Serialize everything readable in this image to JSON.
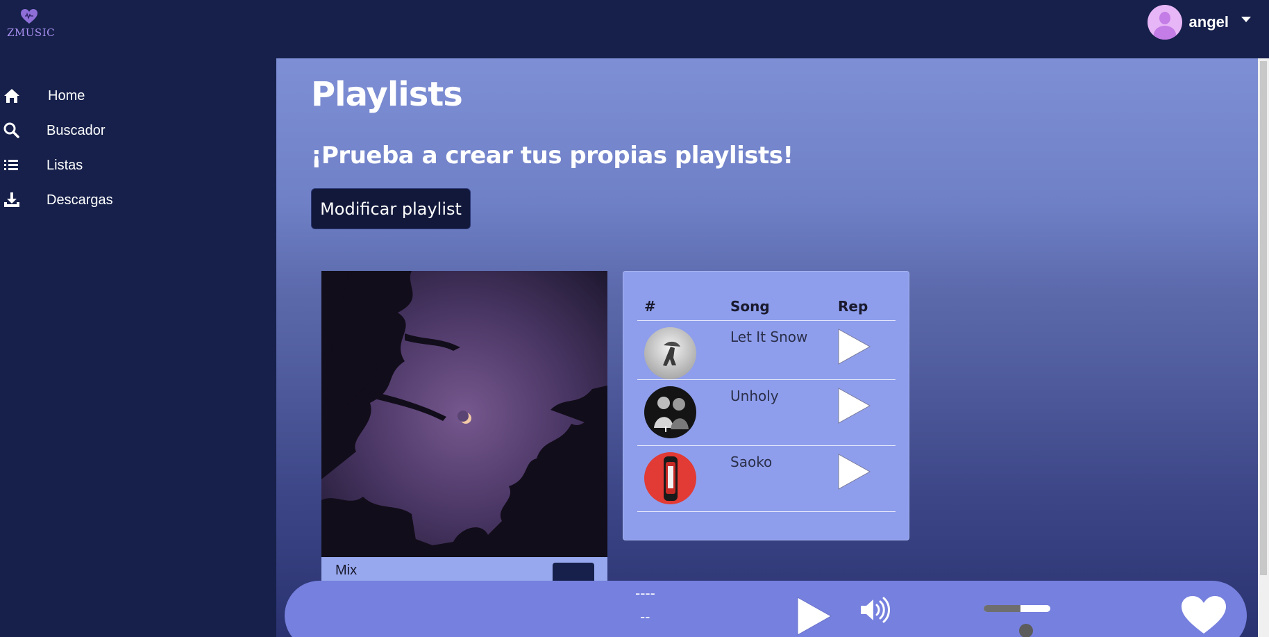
{
  "app": {
    "logo_text": "ZMUSIC"
  },
  "user": {
    "name": "angel"
  },
  "sidebar": {
    "items": [
      {
        "label": "Home",
        "icon": "home-icon"
      },
      {
        "label": "Buscador",
        "icon": "search-icon"
      },
      {
        "label": "Listas",
        "icon": "list-icon"
      },
      {
        "label": "Descargas",
        "icon": "download-icon"
      }
    ]
  },
  "main": {
    "title": "Playlists",
    "subtitle": "¡Prueba a crear tus propias playlists!",
    "modify_button": "Modificar playlist",
    "playlist_card": {
      "name": "Mix"
    },
    "table": {
      "headers": {
        "index": "#",
        "song": "Song",
        "rep": "Rep"
      },
      "rows": [
        {
          "title": "Let It Snow",
          "thumb": "winter-cover"
        },
        {
          "title": "Unholy",
          "thumb": "unholy-cover"
        },
        {
          "title": "Saoko",
          "thumb": "saoko-cover"
        }
      ]
    }
  },
  "player": {
    "title": "----",
    "artist": "--",
    "volume": 0.55
  }
}
